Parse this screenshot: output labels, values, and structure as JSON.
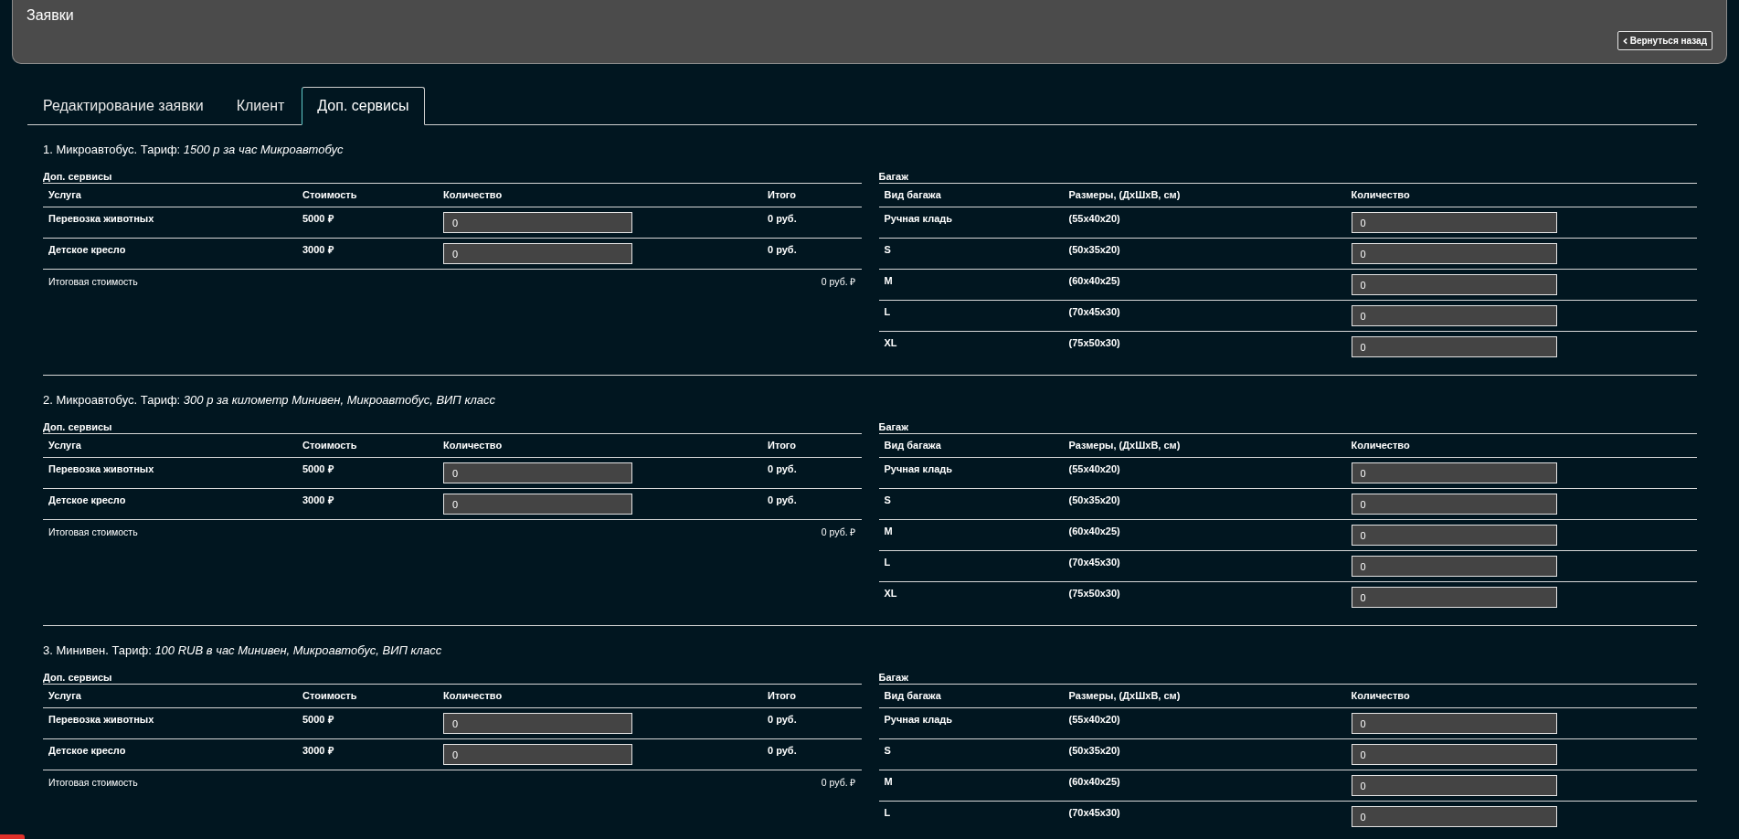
{
  "header": {
    "title": "Заявки",
    "back_button": "Вернуться назад"
  },
  "tabs": [
    {
      "label": "Редактирование заявки",
      "selected": false
    },
    {
      "label": "Клиент",
      "selected": false
    },
    {
      "label": "Доп. сервисы",
      "selected": true
    }
  ],
  "sections": [
    {
      "title": "1. Микроавтобус. Тариф: *1500 р за час Микроавтобус*",
      "services": {
        "caption": "Доп. сервисы",
        "columns": [
          "Услуга",
          "Стоимость",
          "Количество",
          "Итого"
        ],
        "rows": [
          {
            "service": "Перевозка животных",
            "price": "5000 ₽",
            "quantity": "0",
            "total": "0 руб."
          },
          {
            "service": "Детское кресло",
            "price": "3000 ₽",
            "quantity": "0",
            "total": "0 руб."
          }
        ],
        "total_label": "Итоговая стоимость",
        "total_value": "0 руб. ₽"
      },
      "baggage": {
        "caption": "Багаж",
        "columns": [
          "Вид багажа",
          "Размеры, (ДхШхВ, см)",
          "Количество"
        ],
        "rows": [
          {
            "type": "Ручная кладь",
            "size": "(55x40x20)",
            "quantity": "0"
          },
          {
            "type": "S",
            "size": "(50x35x20)",
            "quantity": "0"
          },
          {
            "type": "M",
            "size": "(60x40x25)",
            "quantity": "0"
          },
          {
            "type": "L",
            "size": "(70x45x30)",
            "quantity": "0"
          },
          {
            "type": "XL",
            "size": "(75x50x30)",
            "quantity": "0"
          }
        ]
      }
    },
    {
      "title": "2. Микроавтобус. Тариф: *300 р за километр Минивен, Микроавтобус, ВИП класс*",
      "services": {
        "caption": "Доп. сервисы",
        "columns": [
          "Услуга",
          "Стоимость",
          "Количество",
          "Итого"
        ],
        "rows": [
          {
            "service": "Перевозка животных",
            "price": "5000 ₽",
            "quantity": "0",
            "total": "0 руб."
          },
          {
            "service": "Детское кресло",
            "price": "3000 ₽",
            "quantity": "0",
            "total": "0 руб."
          }
        ],
        "total_label": "Итоговая стоимость",
        "total_value": "0 руб. ₽"
      },
      "baggage": {
        "caption": "Багаж",
        "columns": [
          "Вид багажа",
          "Размеры, (ДхШхВ, см)",
          "Количество"
        ],
        "rows": [
          {
            "type": "Ручная кладь",
            "size": "(55x40x20)",
            "quantity": "0"
          },
          {
            "type": "S",
            "size": "(50x35x20)",
            "quantity": "0"
          },
          {
            "type": "M",
            "size": "(60x40x25)",
            "quantity": "0"
          },
          {
            "type": "L",
            "size": "(70x45x30)",
            "quantity": "0"
          },
          {
            "type": "XL",
            "size": "(75x50x30)",
            "quantity": "0"
          }
        ]
      }
    },
    {
      "title": "3. Минивен. Тариф: *100 RUB в час Минивен, Микроавтобус, ВИП класс*",
      "services": {
        "caption": "Доп. сервисы",
        "columns": [
          "Услуга",
          "Стоимость",
          "Количество",
          "Итого"
        ],
        "rows": [
          {
            "service": "Перевозка животных",
            "price": "5000 ₽",
            "quantity": "0",
            "total": "0 руб."
          },
          {
            "service": "Детское кресло",
            "price": "3000 ₽",
            "quantity": "0",
            "total": "0 руб."
          }
        ],
        "total_label": "Итоговая стоимость",
        "total_value": "0 руб. ₽"
      },
      "baggage": {
        "caption": "Багаж",
        "columns": [
          "Вид багажа",
          "Размеры, (ДхШхВ, см)",
          "Количество"
        ],
        "rows": [
          {
            "type": "Ручная кладь",
            "size": "(55x40x20)",
            "quantity": "0"
          },
          {
            "type": "S",
            "size": "(50x35x20)",
            "quantity": "0"
          },
          {
            "type": "M",
            "size": "(60x40x25)",
            "quantity": "0"
          },
          {
            "type": "L",
            "size": "(70x45x30)",
            "quantity": "0"
          }
        ]
      }
    }
  ]
}
